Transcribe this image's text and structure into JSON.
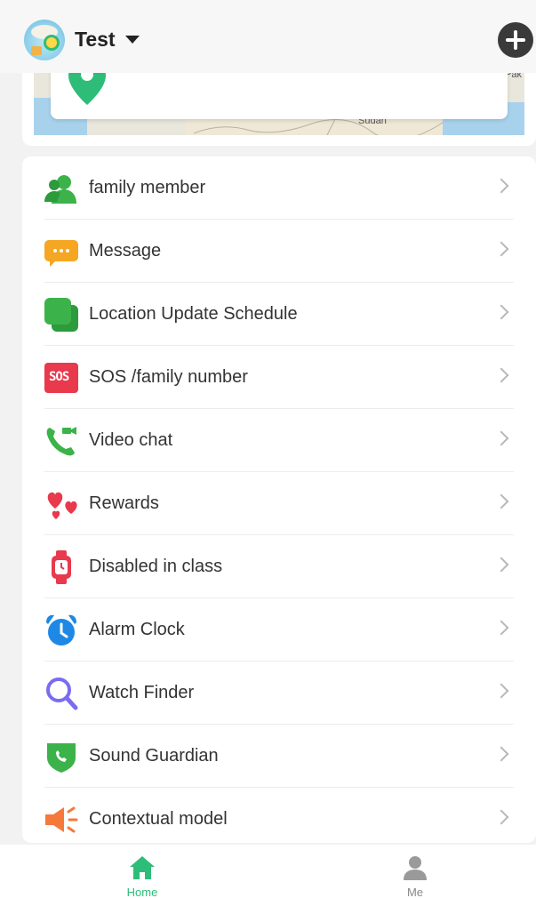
{
  "header": {
    "title": "Test",
    "avatar_icon": "watch-avatar-icon",
    "add_icon": "plus-circle-icon"
  },
  "map": {
    "labels": [
      "Pak",
      "Sudan"
    ],
    "pin_icon": "location-pin-icon",
    "pin_color": "#2ebd78"
  },
  "menu": {
    "items": [
      {
        "label": "family member",
        "icon": "family-member-icon"
      },
      {
        "label": "Message",
        "icon": "message-icon"
      },
      {
        "label": "Location Update Schedule",
        "icon": "location-schedule-icon"
      },
      {
        "label": "SOS /family number",
        "icon": "sos-icon",
        "icon_text": "SOS"
      },
      {
        "label": "Video chat",
        "icon": "video-call-icon"
      },
      {
        "label": "Rewards",
        "icon": "hearts-icon"
      },
      {
        "label": "Disabled in class",
        "icon": "watch-icon"
      },
      {
        "label": "Alarm Clock",
        "icon": "alarm-clock-icon"
      },
      {
        "label": "Watch Finder",
        "icon": "magnifier-icon"
      },
      {
        "label": "Sound Guardian",
        "icon": "shield-phone-icon"
      },
      {
        "label": "Contextual model",
        "icon": "speaker-icon"
      }
    ]
  },
  "bottom_nav": {
    "home": {
      "label": "Home",
      "icon": "home-icon",
      "active": true
    },
    "me": {
      "label": "Me",
      "icon": "person-icon",
      "active": false
    }
  },
  "colors": {
    "accent": "#2ebd78",
    "green": "#3bb34a",
    "orange": "#f5a623",
    "red": "#e8394d",
    "blue": "#1e88e5",
    "purple": "#7a6cf0"
  }
}
